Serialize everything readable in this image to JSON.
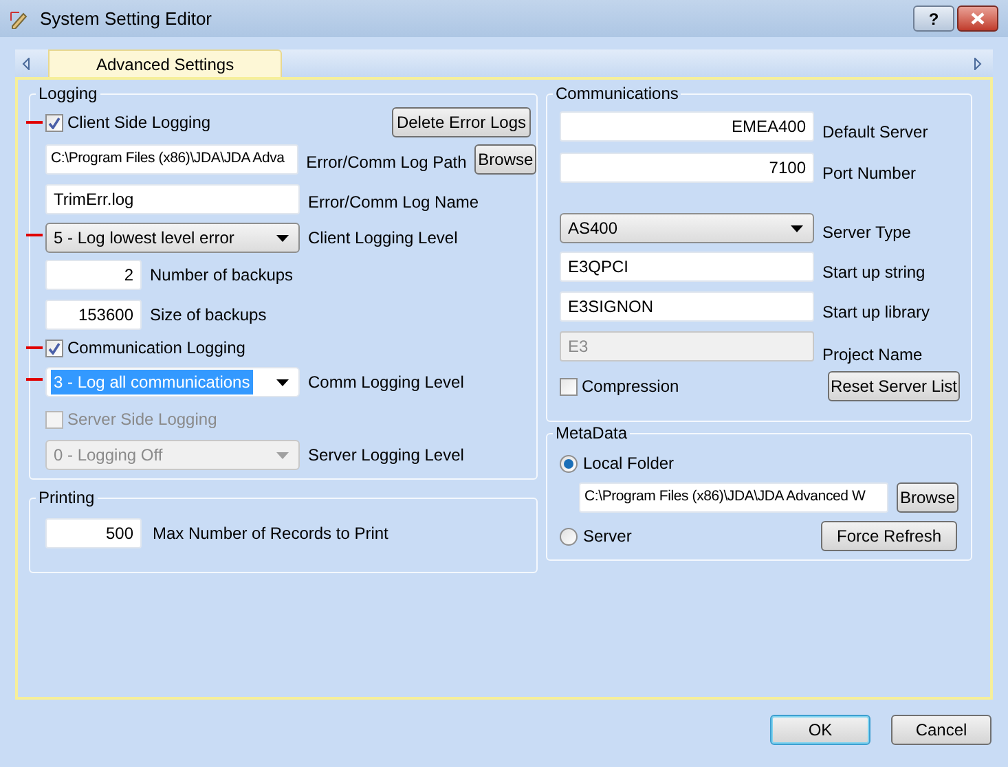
{
  "window": {
    "title": "System Setting Editor",
    "help": "?"
  },
  "tabs": [
    {
      "label": "Advanced Settings",
      "selected": true
    }
  ],
  "logging": {
    "title": "Logging",
    "client_logging": {
      "label": "Client Side Logging",
      "checked": true
    },
    "delete_button": "Delete Error Logs",
    "log_path": {
      "value": "C:\\Program Files (x86)\\JDA\\JDA Adva",
      "label": "Error/Comm Log Path"
    },
    "browse_button": "Browse",
    "log_name": {
      "value": "TrimErr.log",
      "label": "Error/Comm Log Name"
    },
    "client_level": {
      "value": "5 - Log lowest level error",
      "label": "Client Logging Level"
    },
    "backups": {
      "value": "2",
      "label": "Number of backups"
    },
    "backup_size": {
      "value": "153600",
      "label": "Size of backups"
    },
    "comm_logging": {
      "label": "Communication Logging",
      "checked": true
    },
    "comm_level": {
      "value": "3 - Log all communications",
      "label": "Comm Logging Level",
      "focused": true
    },
    "server_logging": {
      "label": "Server Side Logging",
      "checked": false,
      "disabled": true
    },
    "server_level": {
      "value": "0 - Logging Off",
      "label": "Server Logging Level",
      "disabled": true
    }
  },
  "printing": {
    "title": "Printing",
    "max_records": {
      "value": "500",
      "label": "Max Number of Records to Print"
    }
  },
  "communications": {
    "title": "Communications",
    "default_server": {
      "value": "EMEA400",
      "label": "Default Server"
    },
    "port": {
      "value": "7100",
      "label": "Port Number"
    },
    "server_type": {
      "value": "AS400",
      "label": "Server Type"
    },
    "startup_string": {
      "value": "E3QPCI",
      "label": "Start up string"
    },
    "startup_library": {
      "value": "E3SIGNON",
      "label": "Start up library"
    },
    "project_name": {
      "value": "E3",
      "label": "Project Name",
      "disabled": true
    },
    "compression": {
      "label": "Compression",
      "checked": false
    },
    "reset_button": "Reset Server List"
  },
  "metadata": {
    "title": "MetaData",
    "options": [
      {
        "label": "Local Folder",
        "selected": true
      },
      {
        "label": "Server",
        "selected": false
      }
    ],
    "folder_path": "C:\\Program Files (x86)\\JDA\\JDA Advanced W",
    "browse_button": "Browse",
    "refresh_button": "Force Refresh"
  },
  "buttons": [
    {
      "label": "OK",
      "default": true
    },
    {
      "label": "Cancel",
      "default": false
    }
  ]
}
